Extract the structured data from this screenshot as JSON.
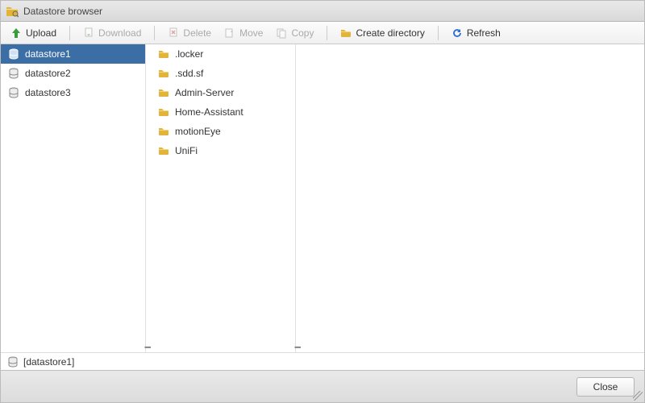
{
  "window": {
    "title": "Datastore browser"
  },
  "toolbar": {
    "upload": "Upload",
    "download": "Download",
    "delete": "Delete",
    "move": "Move",
    "copy": "Copy",
    "create_dir": "Create directory",
    "refresh": "Refresh"
  },
  "datastores": {
    "selected_index": 0,
    "items": [
      {
        "name": "datastore1"
      },
      {
        "name": "datastore2"
      },
      {
        "name": "datastore3"
      }
    ]
  },
  "folders": {
    "items": [
      {
        "name": ".locker"
      },
      {
        "name": ".sdd.sf"
      },
      {
        "name": "Admin-Server"
      },
      {
        "name": "Home-Assistant"
      },
      {
        "name": "motionEye"
      },
      {
        "name": "UniFi"
      }
    ]
  },
  "path": {
    "current": "[datastore1]"
  },
  "footer": {
    "close": "Close"
  }
}
